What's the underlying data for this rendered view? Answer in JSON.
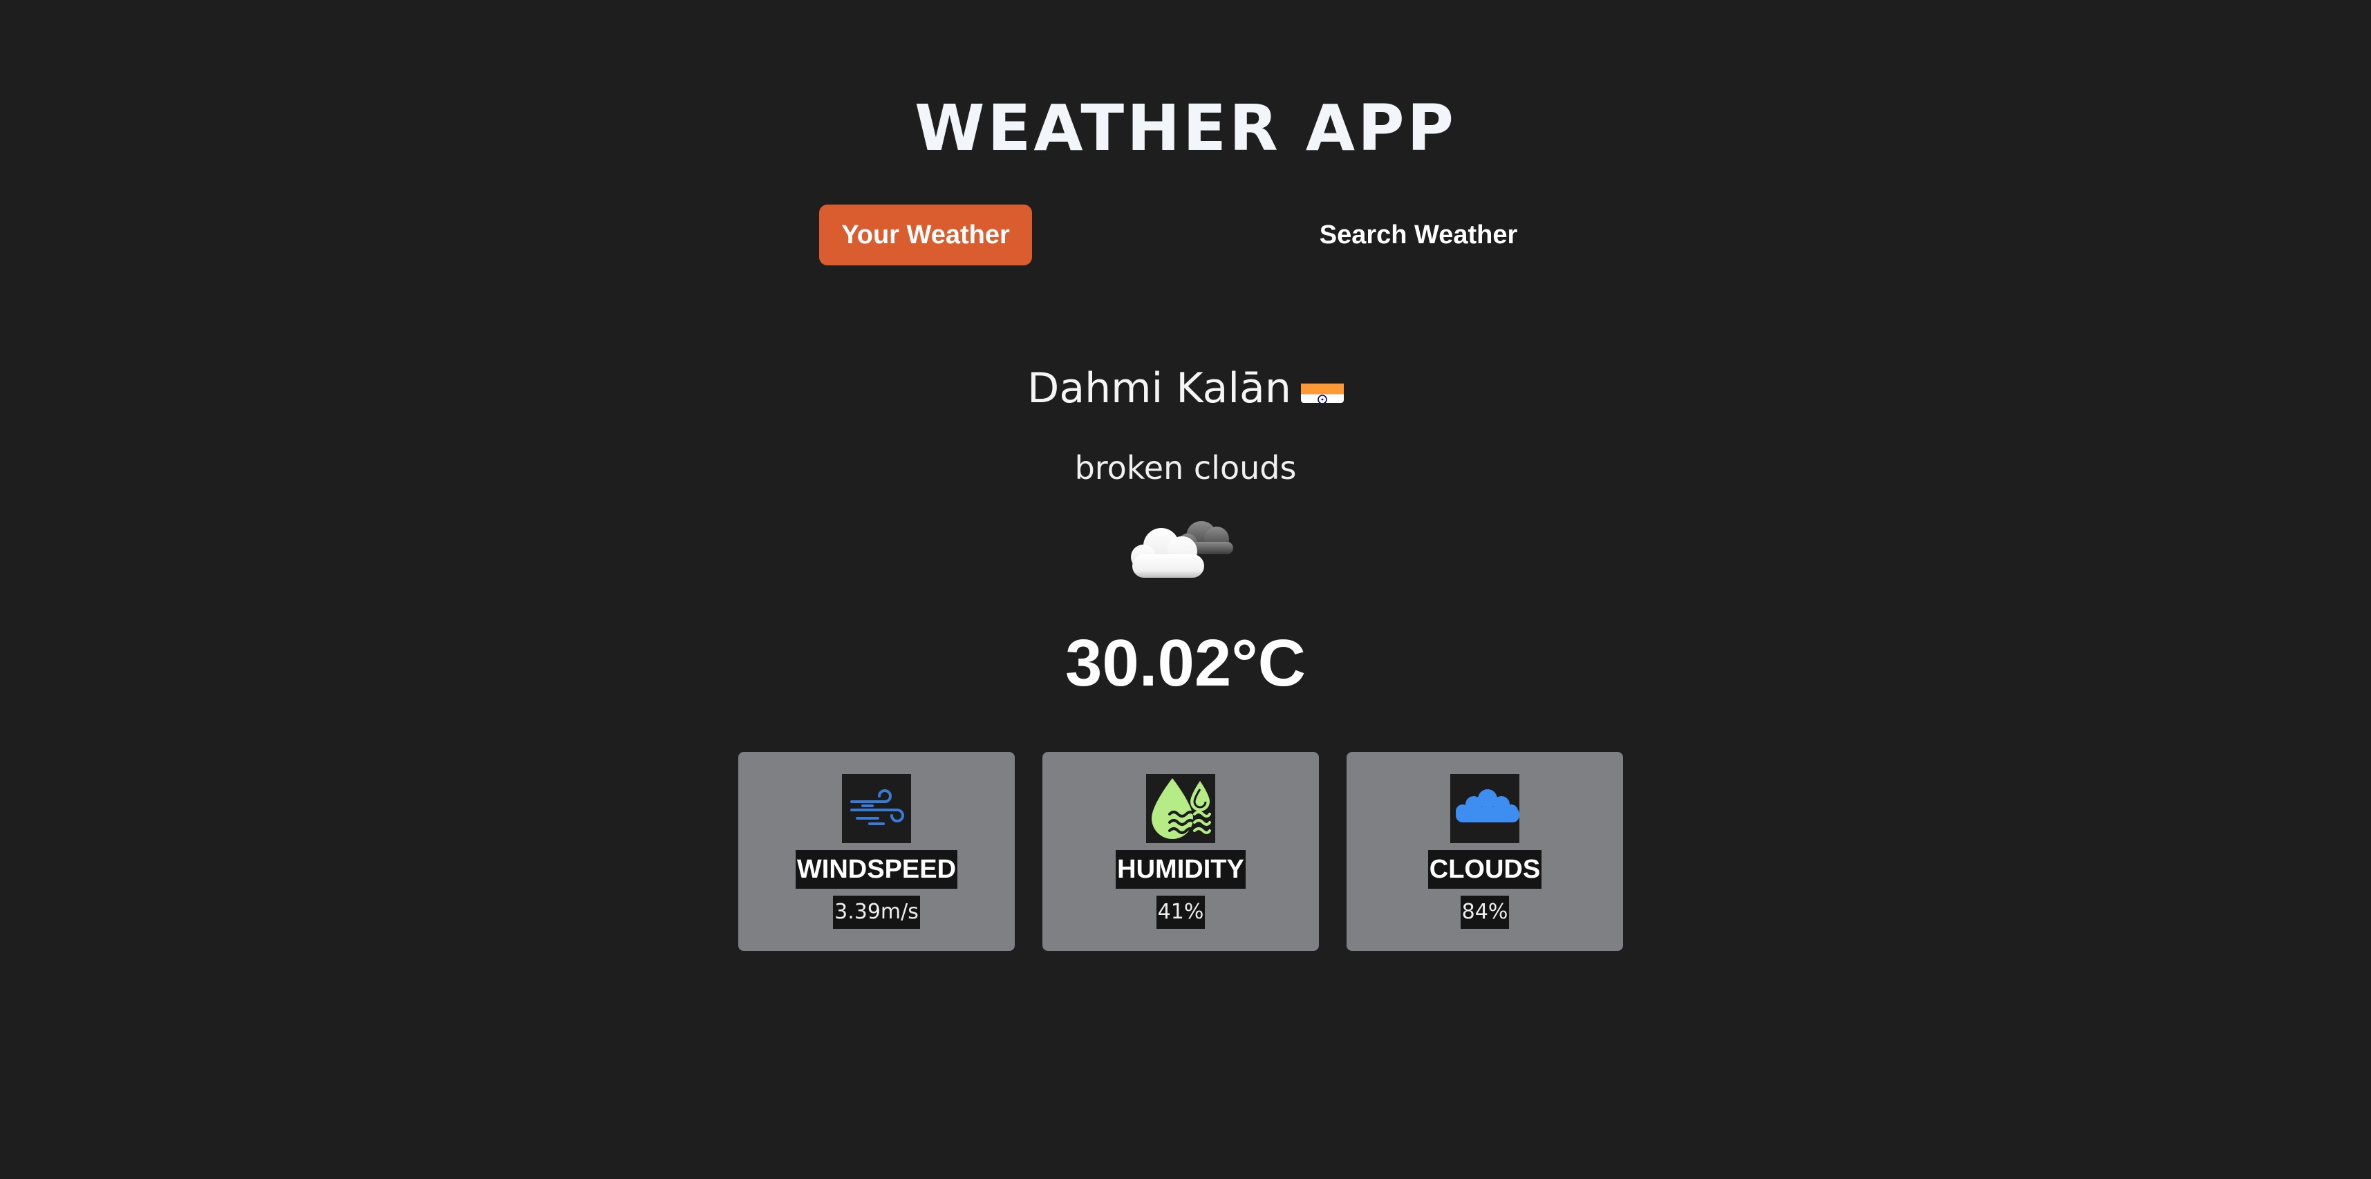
{
  "app": {
    "title": "WEATHER APP"
  },
  "tabs": {
    "your_weather": "Your Weather",
    "search_weather": "Search Weather",
    "active_color": "#d95d2e"
  },
  "location": {
    "city": "Dahmi Kalān",
    "country_flag_icon": "india-flag-icon"
  },
  "weather": {
    "description": "broken clouds",
    "icon": "broken-clouds-icon",
    "temperature": "30.02°C"
  },
  "cards": {
    "windspeed": {
      "label": "WINDSPEED",
      "value": "3.39m/s",
      "icon": "wind-icon",
      "icon_color": "#3a7bd5"
    },
    "humidity": {
      "label": "HUMIDITY",
      "value": "41%",
      "icon": "humidity-drop-icon",
      "icon_color": "#b6ec85"
    },
    "clouds": {
      "label": "CLOUDS",
      "value": "84%",
      "icon": "cloud-icon",
      "icon_color": "#3d8ef0"
    }
  },
  "colors": {
    "background": "#1f1e1e",
    "card_background": "#7f8084"
  }
}
